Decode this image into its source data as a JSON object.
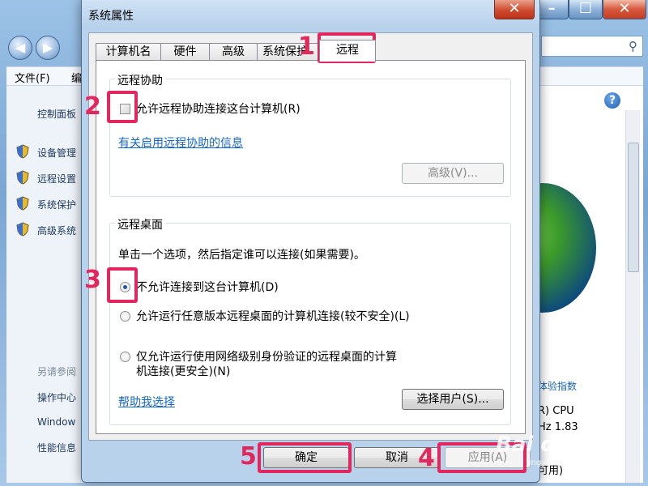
{
  "background_window": {
    "menu": {
      "file": "文件(F)",
      "edit": "编"
    },
    "sidebar": {
      "control_panel": "控制面板",
      "items": [
        {
          "label": "设备管理"
        },
        {
          "label": "远程设置"
        },
        {
          "label": "系统保护"
        },
        {
          "label": "高级系统"
        }
      ],
      "see_also": "另请参阅",
      "see_also_items": [
        {
          "label": "操作中心"
        },
        {
          "label": "Window"
        },
        {
          "label": "性能信息"
        }
      ]
    },
    "right_panel": {
      "experience_index_link": "体验指数",
      "cpu": "R) CPU",
      "ghz": "Hz  1.83",
      "available": "可用)"
    }
  },
  "dialog": {
    "title": "系统属性",
    "close_glyph": "✕",
    "tabs": [
      {
        "label": "计算机名"
      },
      {
        "label": "硬件"
      },
      {
        "label": "高级"
      },
      {
        "label": "系统保护"
      },
      {
        "label": "远程"
      }
    ],
    "active_tab": "远程",
    "remote_assistance": {
      "group_title": "远程协助",
      "checkbox_label": "允许远程协助连接这台计算机(R)",
      "checked": false,
      "info_link": "有关启用远程协助的信息",
      "advanced_button": "高级(V)..."
    },
    "remote_desktop": {
      "group_title": "远程桌面",
      "instruction": "单击一个选项，然后指定谁可以连接(如果需要)。",
      "options": [
        {
          "label": "不允许连接到这台计算机(D)",
          "checked": true
        },
        {
          "label": "允许运行任意版本远程桌面的计算机连接(较不安全)(L)",
          "checked": false
        },
        {
          "label": "仅允许运行使用网络级别身份验证的远程桌面的计算",
          "label_line2": "机连接(更安全)(N)",
          "checked": false
        }
      ],
      "help_link": "帮助我选择",
      "select_users_button": "选择用户(S)..."
    },
    "buttons": {
      "ok": "确定",
      "cancel": "取消",
      "apply": "应用(A)"
    }
  },
  "annotations": [
    "1",
    "2",
    "3",
    "4",
    "5"
  ],
  "watermark": {
    "brand": "Bai du 经验",
    "sub": "jingyan.baidu.com"
  },
  "colors": {
    "annotation": "#e2275f",
    "link": "#1467c4",
    "dialog_frame": "#b8d2ec"
  }
}
